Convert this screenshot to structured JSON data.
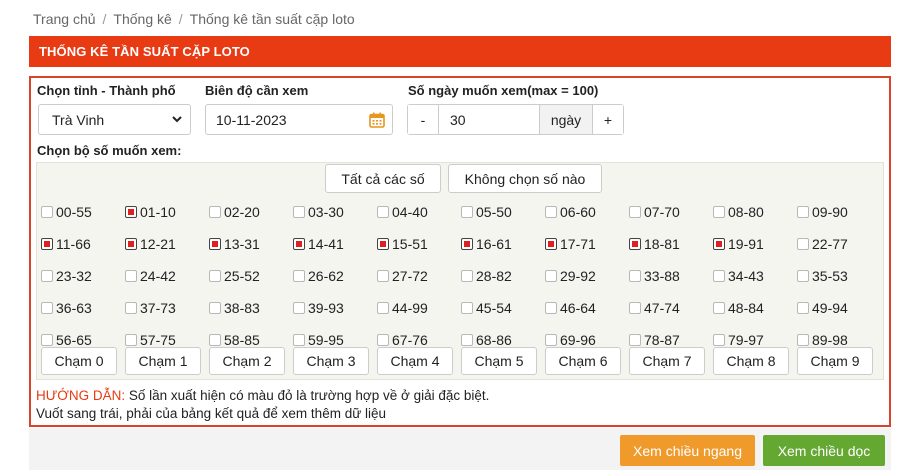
{
  "breadcrumb": [
    "Trang chủ",
    "Thống kê",
    "Thống kê tần suất cặp loto"
  ],
  "header": {
    "title": "THỐNG KÊ TẦN SUẤT CẶP LOTO"
  },
  "form": {
    "province_label": "Chọn tỉnh - Thành phố",
    "province_value": "Trà Vinh",
    "range_label": "Biên độ cần xem",
    "date_value": "10-11-2023",
    "days_label": "Số ngày muốn xem(max = 100)",
    "minus": "-",
    "days_value": "30",
    "days_unit": "ngày",
    "plus": "+",
    "set_label": "Chọn bộ số muốn xem:"
  },
  "buttons": {
    "select_all": "Tất cả các số",
    "select_none": "Không chọn số nào"
  },
  "pairs": [
    [
      {
        "t": "00-55",
        "c": false
      },
      {
        "t": "01-10",
        "c": true
      },
      {
        "t": "02-20",
        "c": false
      },
      {
        "t": "03-30",
        "c": false
      },
      {
        "t": "04-40",
        "c": false
      },
      {
        "t": "05-50",
        "c": false
      },
      {
        "t": "06-60",
        "c": false
      },
      {
        "t": "07-70",
        "c": false
      },
      {
        "t": "08-80",
        "c": false
      },
      {
        "t": "09-90",
        "c": false
      }
    ],
    [
      {
        "t": "11-66",
        "c": true
      },
      {
        "t": "12-21",
        "c": true
      },
      {
        "t": "13-31",
        "c": true
      },
      {
        "t": "14-41",
        "c": true
      },
      {
        "t": "15-51",
        "c": true
      },
      {
        "t": "16-61",
        "c": true
      },
      {
        "t": "17-71",
        "c": true
      },
      {
        "t": "18-81",
        "c": true
      },
      {
        "t": "19-91",
        "c": true
      },
      {
        "t": "22-77",
        "c": false
      }
    ],
    [
      {
        "t": "23-32",
        "c": false
      },
      {
        "t": "24-42",
        "c": false
      },
      {
        "t": "25-52",
        "c": false
      },
      {
        "t": "26-62",
        "c": false
      },
      {
        "t": "27-72",
        "c": false
      },
      {
        "t": "28-82",
        "c": false
      },
      {
        "t": "29-92",
        "c": false
      },
      {
        "t": "33-88",
        "c": false
      },
      {
        "t": "34-43",
        "c": false
      },
      {
        "t": "35-53",
        "c": false
      }
    ],
    [
      {
        "t": "36-63",
        "c": false
      },
      {
        "t": "37-73",
        "c": false
      },
      {
        "t": "38-83",
        "c": false
      },
      {
        "t": "39-93",
        "c": false
      },
      {
        "t": "44-99",
        "c": false
      },
      {
        "t": "45-54",
        "c": false
      },
      {
        "t": "46-64",
        "c": false
      },
      {
        "t": "47-74",
        "c": false
      },
      {
        "t": "48-84",
        "c": false
      },
      {
        "t": "49-94",
        "c": false
      }
    ],
    [
      {
        "t": "56-65",
        "c": false
      },
      {
        "t": "57-75",
        "c": false
      },
      {
        "t": "58-85",
        "c": false
      },
      {
        "t": "59-95",
        "c": false
      },
      {
        "t": "67-76",
        "c": false
      },
      {
        "t": "68-86",
        "c": false
      },
      {
        "t": "69-96",
        "c": false
      },
      {
        "t": "78-87",
        "c": false
      },
      {
        "t": "79-97",
        "c": false
      },
      {
        "t": "89-98",
        "c": false
      }
    ]
  ],
  "cham": [
    "Chạm 0",
    "Chạm 1",
    "Chạm 2",
    "Chạm 3",
    "Chạm 4",
    "Chạm 5",
    "Chạm 6",
    "Chạm 7",
    "Chạm 8",
    "Chạm 9"
  ],
  "guide": {
    "prefix": "HƯỚNG DẪN:",
    "line1": " Số lần xuất hiện có màu đỏ là trường hợp về ở giải đặc biệt.",
    "line2": "Vuốt sang trái, phải của bảng kết quả để xem thêm dữ liệu"
  },
  "actions": {
    "horizontal": "Xem chiều ngang",
    "vertical": "Xem chiều dọc"
  },
  "colors": {
    "header": "#e83a13",
    "horizontal_btn": "#ef9a2b",
    "vertical_btn": "#64a832",
    "checked_mark": "#e02020"
  },
  "icons": {
    "province_select": "chevron-down-icon",
    "date": "calendar-icon"
  }
}
